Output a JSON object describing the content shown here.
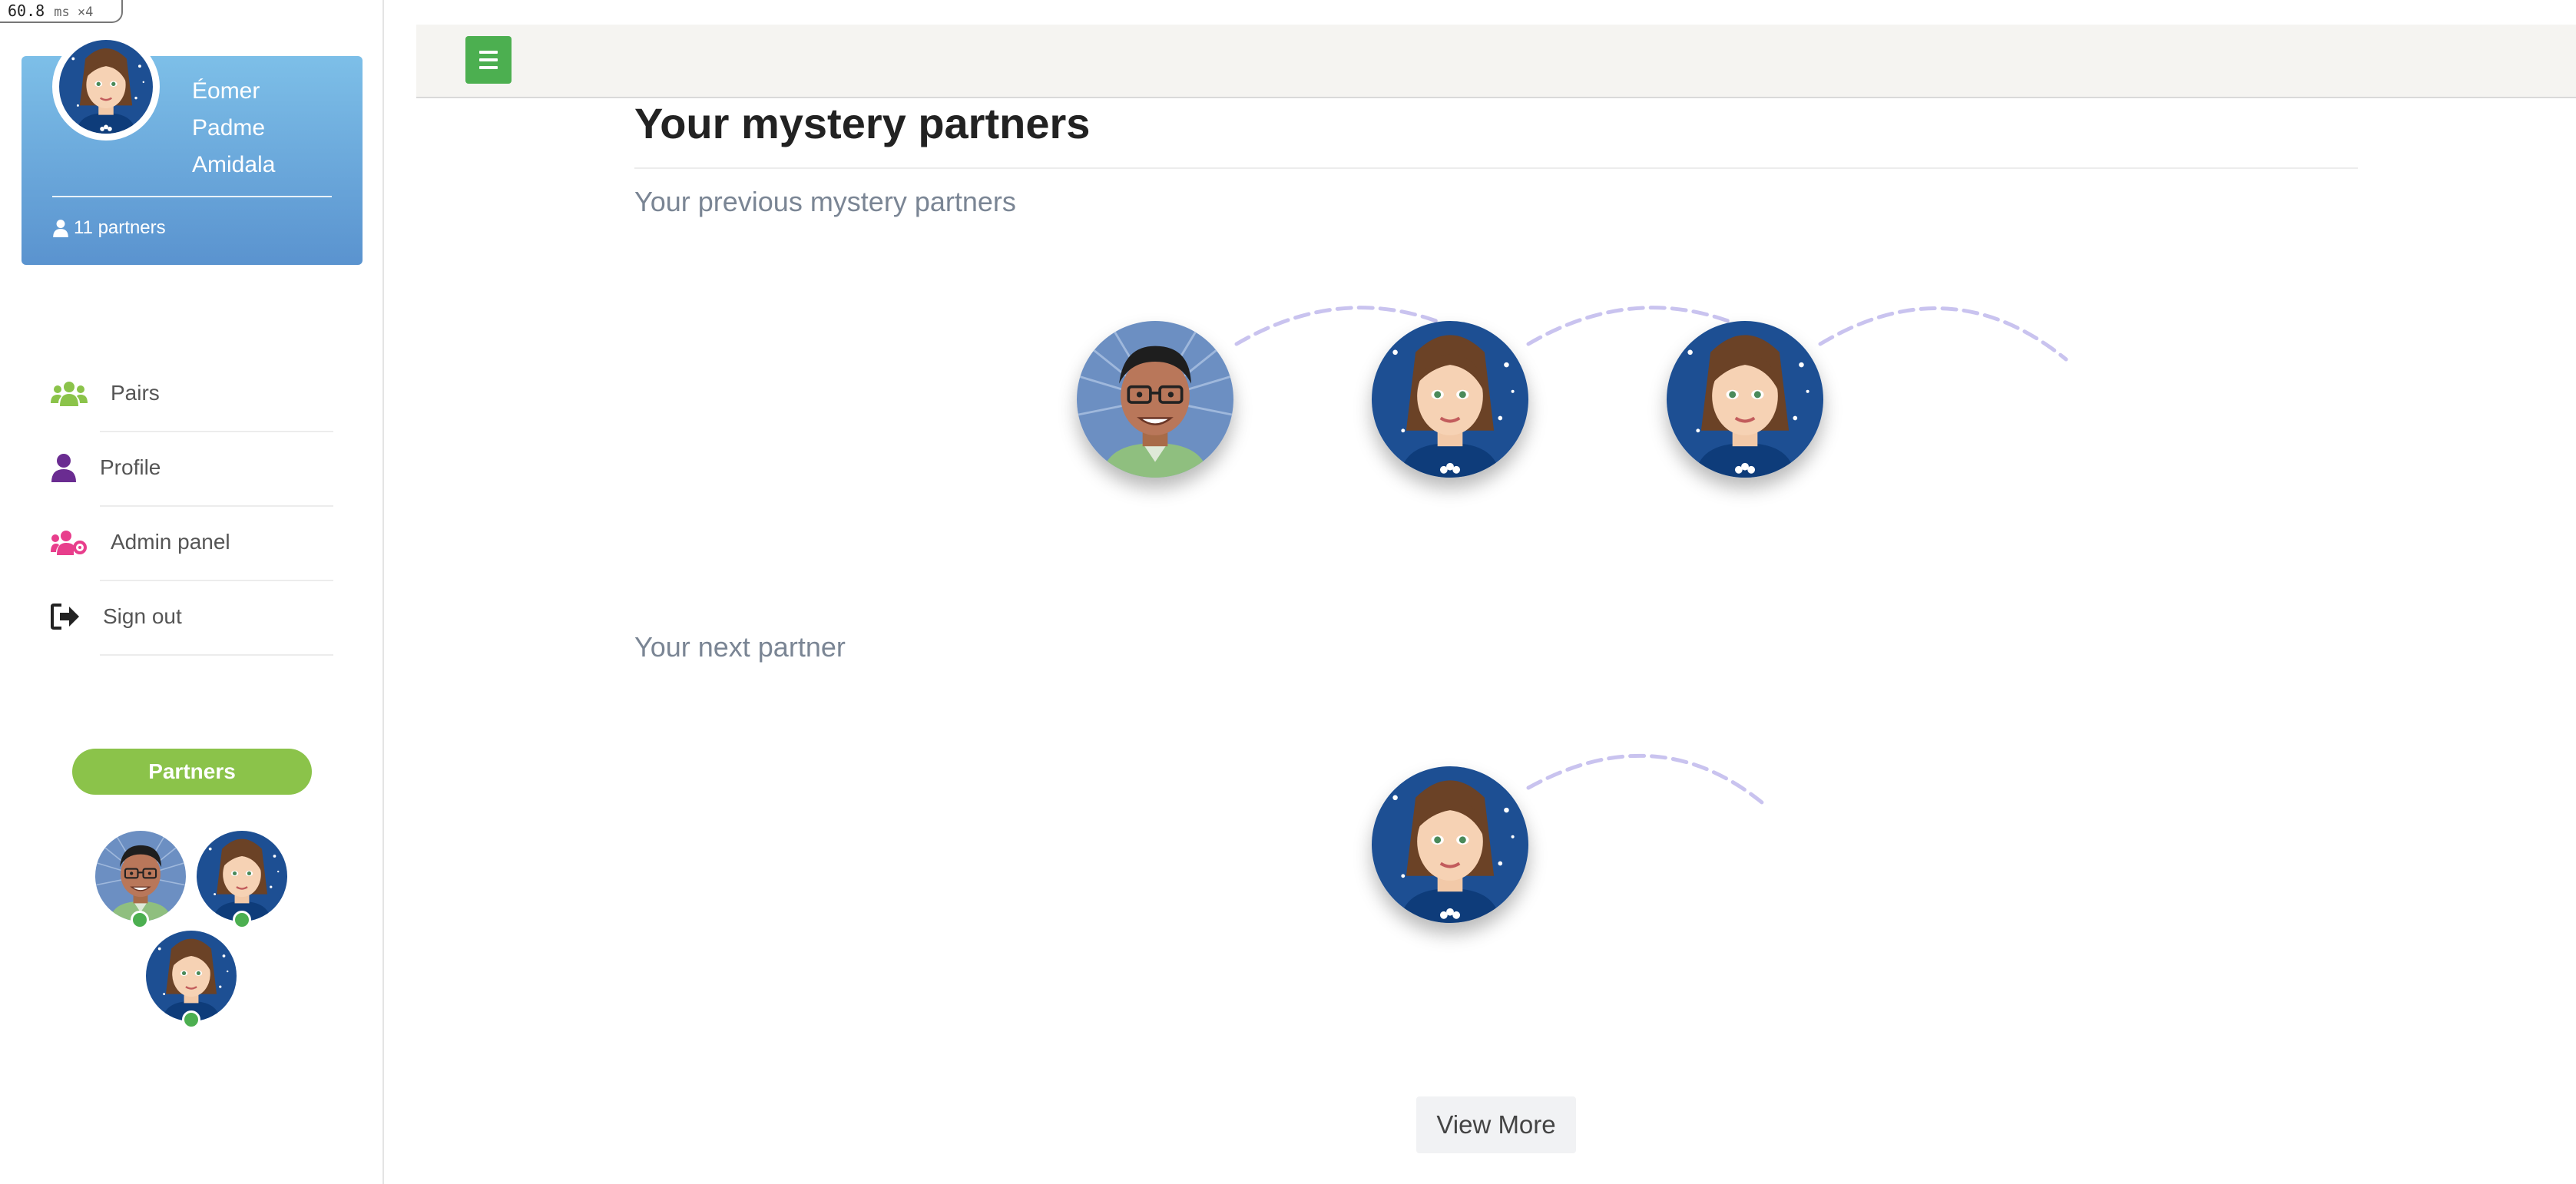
{
  "perf": {
    "value": "60.8",
    "unit": "ms ×4"
  },
  "user": {
    "name_lines": [
      "Éomer",
      "Padme",
      "Amidala"
    ],
    "partners_label": "11 partners"
  },
  "nav": {
    "items": [
      {
        "label": "Pairs",
        "icon": "users-icon",
        "color": "#8bc34a"
      },
      {
        "label": "Profile",
        "icon": "user-icon",
        "color": "#6a2c91"
      },
      {
        "label": "Admin panel",
        "icon": "users-cog-icon",
        "color": "#e83e8c"
      },
      {
        "label": "Sign out",
        "icon": "sign-out-icon",
        "color": "#222222"
      }
    ]
  },
  "partners_button": "Partners",
  "main": {
    "title": "Your mystery partners",
    "previous_label": "Your previous mystery partners",
    "next_label": "Your next partner",
    "view_more": "View More"
  },
  "colors": {
    "card_top": "#7dbfe8",
    "card_bottom": "#5a93cf",
    "accent_green": "#8bc34a",
    "menu_button": "#4caf50",
    "arc": "#c9c3ef"
  }
}
